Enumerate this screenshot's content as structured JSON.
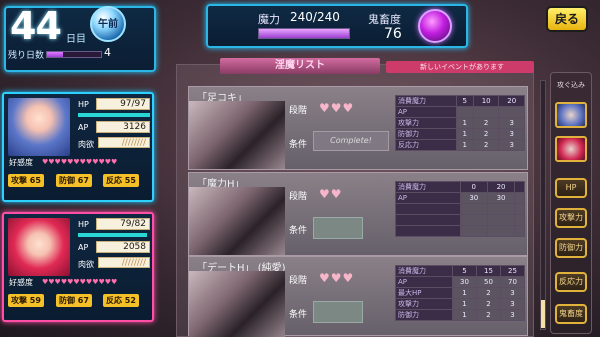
{
  "day": {
    "number": "44",
    "unit": "日目",
    "period": "午前",
    "remaining_label": "残り日数",
    "remaining_value": "4",
    "remaining_ratio": 0.3
  },
  "status": {
    "mp_label": "魔力",
    "mp_value": "240/240",
    "mp_ratio": 1.0,
    "demon_label": "鬼畜度",
    "demon_value": "76"
  },
  "back_label": "戻る",
  "list": {
    "tab_label": "淫魔リスト",
    "notice": "新しいイベントがあります"
  },
  "cards": [
    {
      "title": "「足コキ」",
      "level_label": "段階",
      "hearts": "♥♥♥",
      "cond_label": "条件",
      "cond_value": "Complete!",
      "table": [
        [
          "消費魔力",
          "5",
          "10",
          "20"
        ],
        [
          "AP",
          "",
          "",
          ""
        ],
        [
          "攻撃力",
          "1",
          "2",
          "3"
        ],
        [
          "防御力",
          "1",
          "2",
          "3"
        ],
        [
          "反応力",
          "1",
          "2",
          "3"
        ]
      ]
    },
    {
      "title": "「魔力H」",
      "level_label": "段階",
      "hearts": "♥♥",
      "cond_label": "条件",
      "cond_value": "",
      "table": [
        [
          "消費魔力",
          "0",
          "20",
          ""
        ],
        [
          "AP",
          "30",
          "30",
          ""
        ],
        [
          "",
          "",
          "",
          ""
        ],
        [
          "",
          "",
          "",
          ""
        ],
        [
          "",
          "",
          "",
          ""
        ]
      ]
    },
    {
      "title": "「デートH」 (純愛)",
      "level_label": "段階",
      "hearts": "♥♥♥",
      "cond_label": "条件",
      "cond_value": "",
      "table": [
        [
          "消費魔力",
          "5",
          "15",
          "25"
        ],
        [
          "AP",
          "30",
          "50",
          "70"
        ],
        [
          "最大HP",
          "1",
          "2",
          "3"
        ],
        [
          "攻撃力",
          "1",
          "2",
          "3"
        ],
        [
          "防御力",
          "1",
          "2",
          "3"
        ]
      ]
    }
  ],
  "characters": [
    {
      "hp_label": "HP",
      "hp_value": "97/97",
      "hp_ratio": 1.0,
      "ap_label": "AP",
      "ap_value": "3126",
      "lust_label": "肉欲",
      "lust_value": "////////",
      "affection_label": "好感度",
      "affection_hearts": "♥♥♥♥♥♥♥♥♥♥♥♥",
      "atk_label": "攻撃",
      "atk_value": "65",
      "def_label": "防御",
      "def_value": "67",
      "reflex_label": "反応",
      "reflex_value": "55"
    },
    {
      "hp_label": "HP",
      "hp_value": "79/82",
      "hp_ratio": 0.96,
      "ap_label": "AP",
      "ap_value": "2058",
      "lust_label": "肉欲",
      "lust_value": "////////",
      "affection_label": "好感度",
      "affection_hearts": "♥♥♥♥♥♥♥♥♥♥♥♥",
      "atk_label": "攻撃",
      "atk_value": "59",
      "def_label": "防御",
      "def_value": "67",
      "reflex_label": "反応",
      "reflex_value": "52"
    }
  ],
  "sidebar": {
    "title": "攻ぐ込み",
    "buttons": [
      "HP",
      "攻撃力",
      "防御力",
      "反応力",
      "鬼畜度"
    ]
  }
}
